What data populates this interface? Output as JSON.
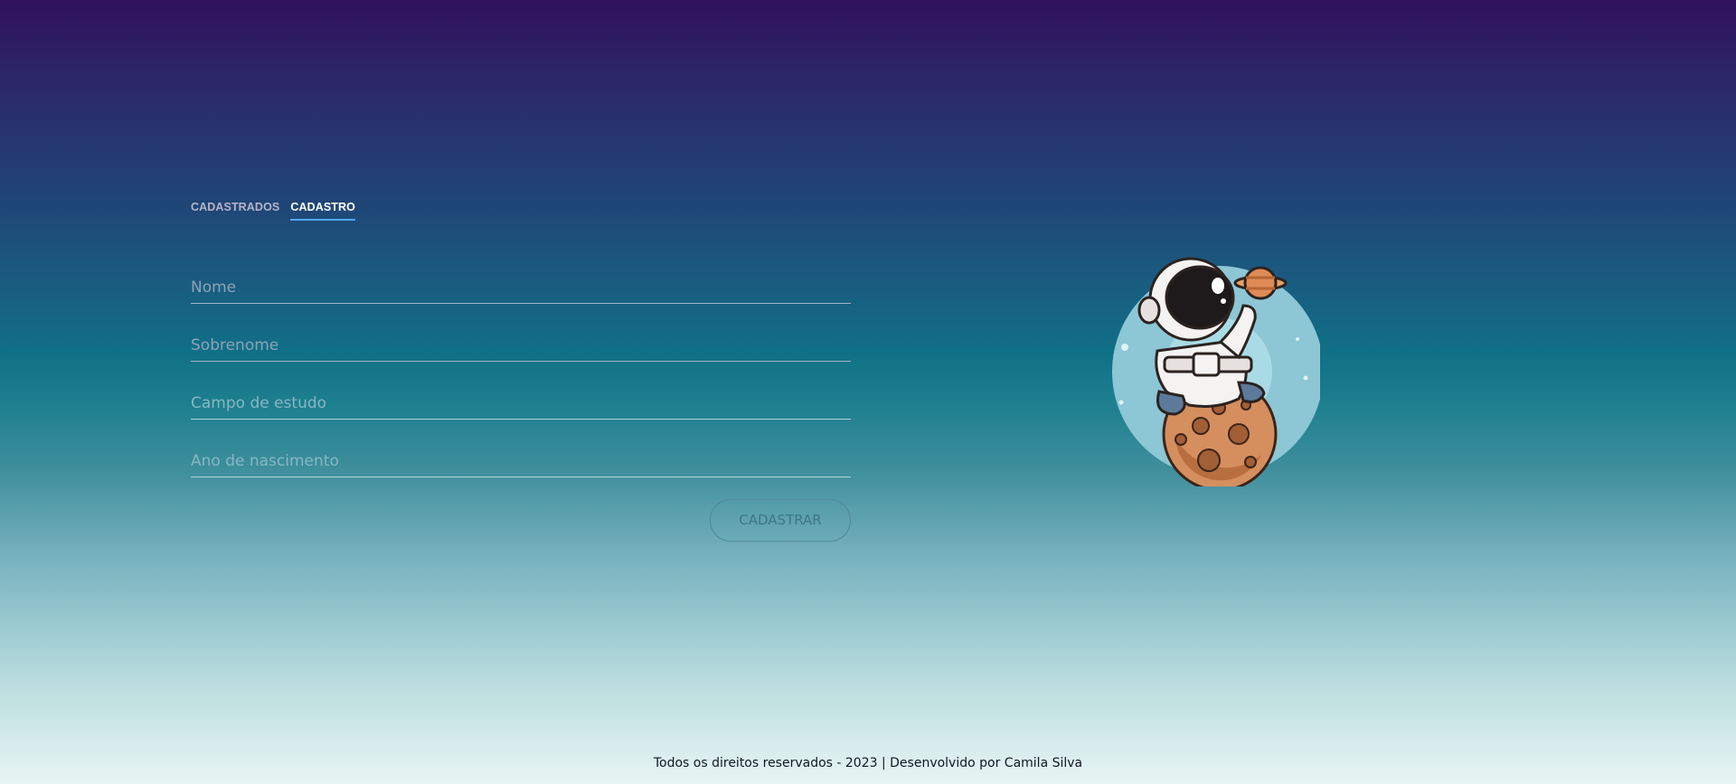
{
  "tabs": [
    {
      "label": "CADASTRADOS",
      "active": false
    },
    {
      "label": "CADASTRO",
      "active": true
    }
  ],
  "form": {
    "fields": [
      {
        "placeholder": "Nome",
        "value": ""
      },
      {
        "placeholder": "Sobrenome",
        "value": ""
      },
      {
        "placeholder": "Campo de estudo",
        "value": ""
      },
      {
        "placeholder": "Ano de nascimento",
        "value": ""
      }
    ],
    "submit_label": "CADASTRAR"
  },
  "illustration": {
    "icon": "astronaut-on-planet-illustration"
  },
  "footer": {
    "text": "Todos os direitos reservados - 2023 | Desenvolvido por Camila Silva"
  },
  "colors": {
    "tab_active_underline": "#4ea8f5",
    "gradient_top": "#31115e",
    "gradient_bottom": "#e7f5f3"
  }
}
